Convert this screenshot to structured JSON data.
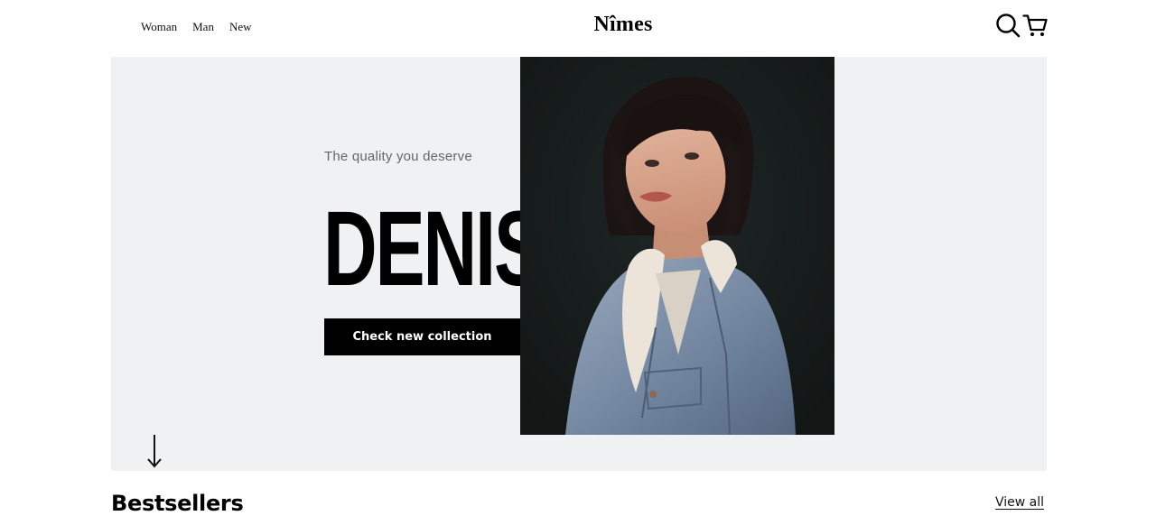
{
  "nav": {
    "links": [
      {
        "label": "Woman"
      },
      {
        "label": "Man"
      },
      {
        "label": "New"
      }
    ],
    "logo": "Nîmes",
    "icons": [
      "search-icon",
      "cart-icon"
    ]
  },
  "hero": {
    "tagline": "The quality you deserve",
    "headline": "DENIS",
    "cta_label": "Check new collection",
    "image": "woman-in-denim-jacket-photo",
    "scroll_icon": "arrow-down-icon",
    "background_color": "#f0f1f2"
  },
  "bestsellers": {
    "title": "Bestsellers",
    "view_all": "View all"
  },
  "colors": {
    "text": "#000000",
    "button_bg": "#000000",
    "button_text": "#ffffff",
    "photo_bg": "#161b1a"
  }
}
